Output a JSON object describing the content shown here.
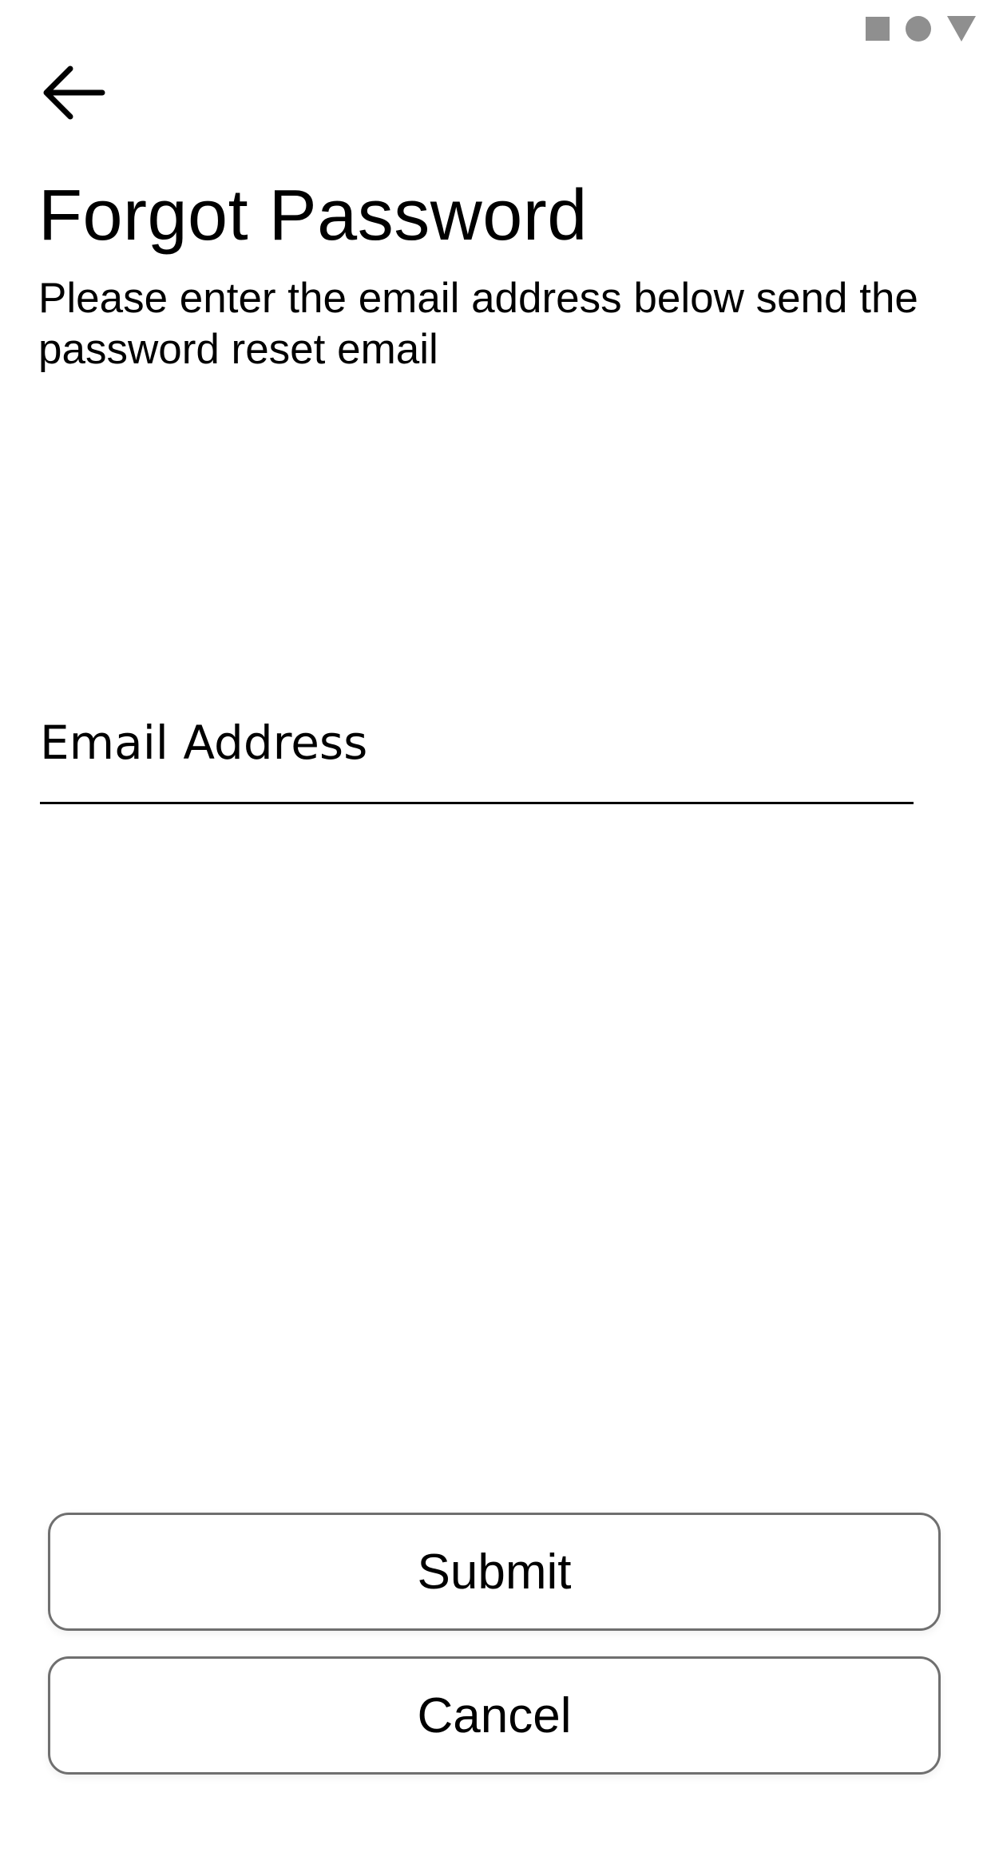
{
  "status_bar": {
    "icons": [
      "square-icon",
      "circle-icon",
      "triangle-icon"
    ]
  },
  "header": {
    "back_icon": "arrow-left-icon",
    "title": "Forgot Password",
    "subtitle": "Please enter the email address  below send the password reset email"
  },
  "form": {
    "email_placeholder": "Email Address",
    "email_value": ""
  },
  "actions": {
    "submit_label": "Submit",
    "cancel_label": "Cancel"
  },
  "colors": {
    "background": "#ffffff",
    "text": "#000000",
    "button_border": "#6f6f6f",
    "status_icon": "#8f8f8f"
  }
}
